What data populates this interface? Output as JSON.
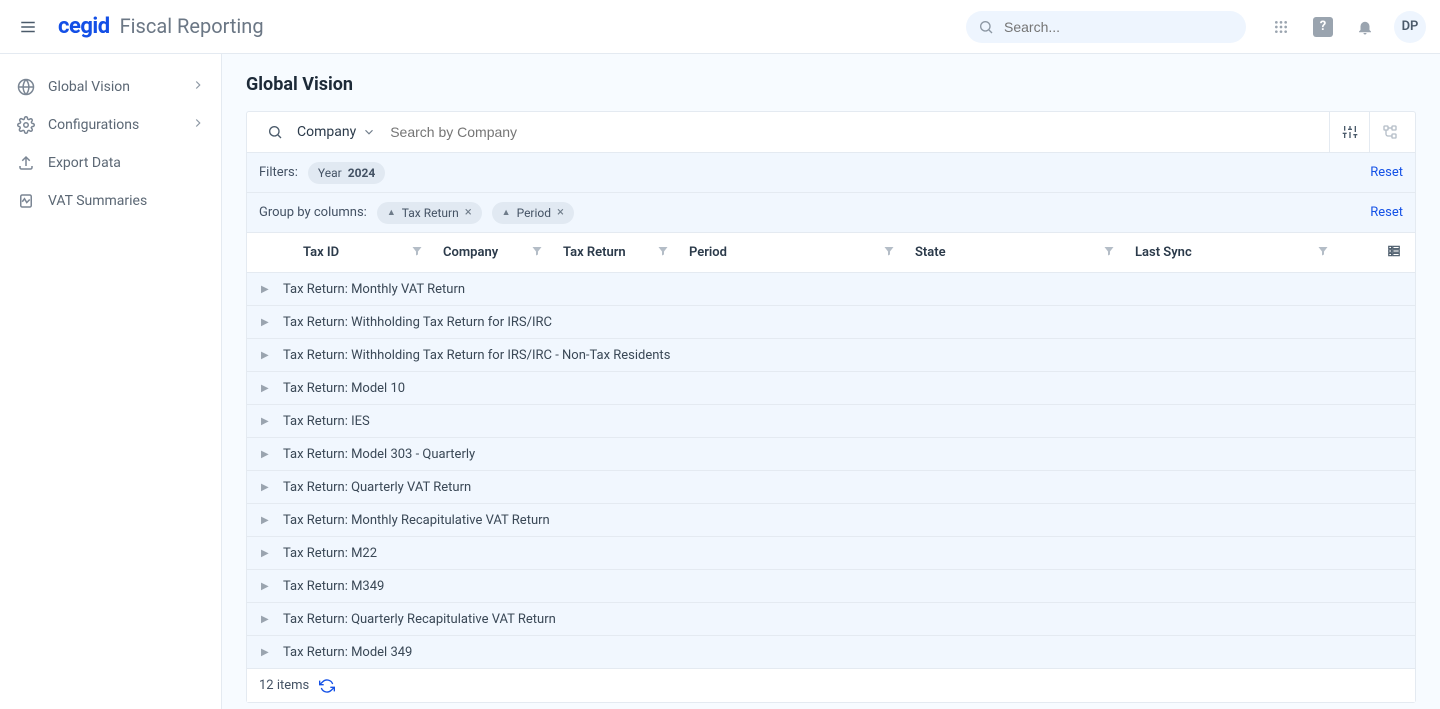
{
  "topbar": {
    "brand_logo": "cegid",
    "brand_sub": "Fiscal Reporting",
    "search_placeholder": "Search...",
    "avatar_initials": "DP"
  },
  "sidebar": {
    "items": [
      {
        "icon": "globe-icon",
        "label": "Global Vision",
        "expandable": true
      },
      {
        "icon": "gear-icon",
        "label": "Configurations",
        "expandable": true
      },
      {
        "icon": "upload-icon",
        "label": "Export Data",
        "expandable": false
      },
      {
        "icon": "waveform-icon",
        "label": "VAT Summaries",
        "expandable": false
      }
    ]
  },
  "page": {
    "title": "Global Vision"
  },
  "searchbar": {
    "selector_label": "Company",
    "placeholder": "Search by Company"
  },
  "filters": {
    "label": "Filters:",
    "chips": [
      {
        "prefix": "Year",
        "value": "2024"
      }
    ],
    "reset": "Reset"
  },
  "grouping": {
    "label": "Group by columns:",
    "chips": [
      {
        "label": "Tax Return"
      },
      {
        "label": "Period"
      }
    ],
    "reset": "Reset"
  },
  "columns": {
    "tax_id": "Tax ID",
    "company": "Company",
    "tax_return": "Tax Return",
    "period": "Period",
    "state": "State",
    "last_sync": "Last Sync"
  },
  "groups": [
    "Tax Return: Monthly VAT Return",
    "Tax Return: Withholding Tax Return for IRS/IRC",
    "Tax Return: Withholding Tax Return for IRS/IRC - Non-Tax Residents",
    "Tax Return: Model 10",
    "Tax Return: IES",
    "Tax Return: Model 303 - Quarterly",
    "Tax Return: Quarterly VAT Return",
    "Tax Return: Monthly Recapitulative VAT Return",
    "Tax Return: M22",
    "Tax Return: M349",
    "Tax Return: Quarterly Recapitulative VAT Return",
    "Tax Return: Model 349"
  ],
  "footer": {
    "count_text": "12 items"
  }
}
